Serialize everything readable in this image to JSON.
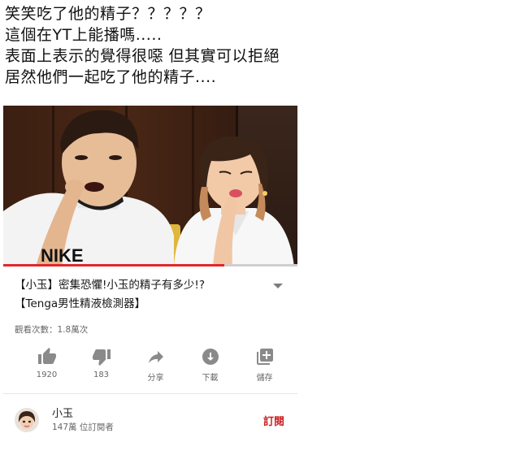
{
  "post": {
    "lines": [
      "笑笑吃了他的精子？？？？？",
      "這個在YT上能播嗎.....",
      "表面上表示的覺得很噁 但其實可以拒絕",
      "居然他們一起吃了他的精子...."
    ]
  },
  "video": {
    "watermark_text": "NIKE",
    "progress": 0.75,
    "progress_color": "#e1262b"
  },
  "meta": {
    "title_line1": "【小玉】密集恐懼!小玉的精子有多少!?",
    "title_line2": "【Tenga男性精液檢測器】",
    "views": "觀看次數：1.8萬次"
  },
  "actions": [
    {
      "icon": "thumbs-up-icon",
      "label": "1920"
    },
    {
      "icon": "thumbs-down-icon",
      "label": "183"
    },
    {
      "icon": "share-icon",
      "label": "分享"
    },
    {
      "icon": "download-icon",
      "label": "下載"
    },
    {
      "icon": "add-to-playlist-icon",
      "label": "儲存"
    }
  ],
  "channel": {
    "name": "小玉",
    "subscribers": "147萬 位訂閱者",
    "subscribe_label": "訂閱",
    "subscribe_color": "#cc1f1f"
  }
}
